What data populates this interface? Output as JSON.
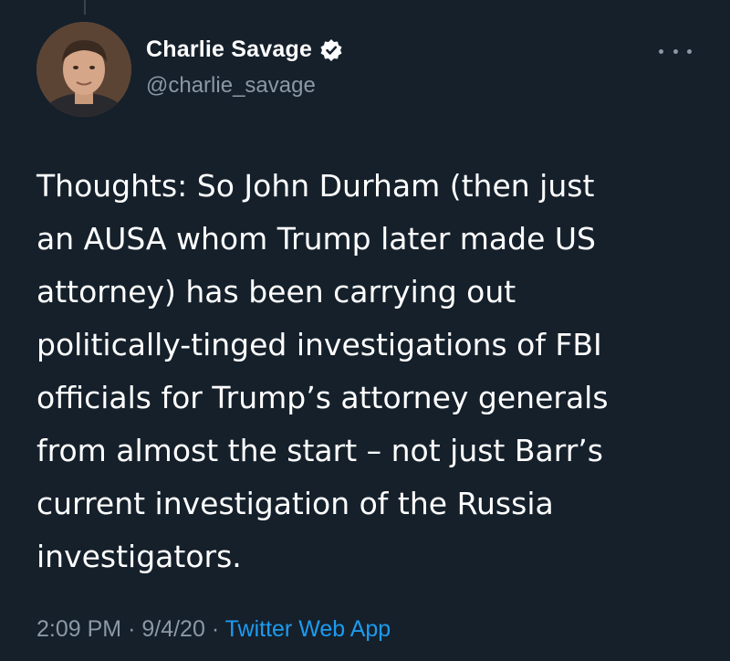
{
  "author": {
    "display_name": "Charlie Savage",
    "handle": "@charlie_savage",
    "verified": true
  },
  "tweet": {
    "lines": [
      "Thoughts: So John Durham (then just",
      "an AUSA whom Trump later made US",
      "attorney) has been carrying out",
      "politically-tinged investigations of FBI",
      "officials for Trump’s attorney generals",
      "from almost the start – not just Barr’s",
      "current investigation of the Russia",
      "investigators."
    ],
    "time": "2:09 PM",
    "separator": "·",
    "date": "9/4/20",
    "source": "Twitter Web App"
  },
  "icons": {
    "verified": "verified-badge-icon",
    "more": "more-options-icon"
  },
  "colors": {
    "background": "#15202b",
    "text": "#ffffff",
    "secondary": "#8b98a5",
    "link": "#1d9bf0"
  }
}
